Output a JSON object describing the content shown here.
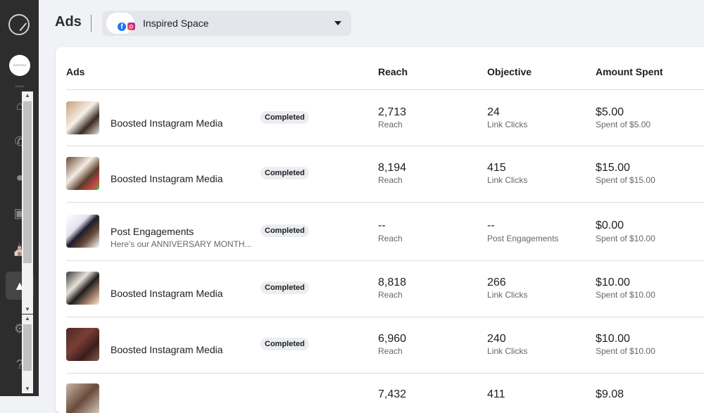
{
  "header": {
    "title": "Ads",
    "account_name": "Inspired Space",
    "brand_logo_text": "INSPIRED SPACE"
  },
  "table": {
    "columns": [
      "Ads",
      "Reach",
      "Objective",
      "Amount Spent"
    ],
    "rows": [
      {
        "name": "Boosted Instagram Media",
        "subtitle": "",
        "status": "Completed",
        "reach": "2,713",
        "reach_label": "Reach",
        "objective_value": "24",
        "objective_label": "Link Clicks",
        "spent": "$5.00",
        "spent_of": "Spent of $5.00"
      },
      {
        "name": "Boosted Instagram Media",
        "subtitle": "",
        "status": "Completed",
        "reach": "8,194",
        "reach_label": "Reach",
        "objective_value": "415",
        "objective_label": "Link Clicks",
        "spent": "$15.00",
        "spent_of": "Spent of $15.00"
      },
      {
        "name": "Post Engagements",
        "subtitle": "Here's our ANNIVERSARY MONTH...",
        "status": "Completed",
        "reach": "--",
        "reach_label": "Reach",
        "objective_value": "--",
        "objective_label": "Post Engagements",
        "spent": "$0.00",
        "spent_of": "Spent of $10.00"
      },
      {
        "name": "Boosted Instagram Media",
        "subtitle": "",
        "status": "Completed",
        "reach": "8,818",
        "reach_label": "Reach",
        "objective_value": "266",
        "objective_label": "Link Clicks",
        "spent": "$10.00",
        "spent_of": "Spent of $10.00"
      },
      {
        "name": "Boosted Instagram Media",
        "subtitle": "",
        "status": "Completed",
        "reach": "6,960",
        "reach_label": "Reach",
        "objective_value": "240",
        "objective_label": "Link Clicks",
        "spent": "$10.00",
        "spent_of": "Spent of $10.00"
      },
      {
        "name": "",
        "subtitle": "",
        "status": "",
        "reach": "7,432",
        "reach_label": "",
        "objective_value": "411",
        "objective_label": "",
        "spent": "$9.08",
        "spent_of": ""
      }
    ]
  },
  "icons": [
    "logo-icon",
    "home-icon",
    "whatsapp-icon",
    "chat-icon",
    "monitor-icon",
    "cart-icon",
    "megaphone-icon",
    "gear-icon",
    "help-icon"
  ]
}
